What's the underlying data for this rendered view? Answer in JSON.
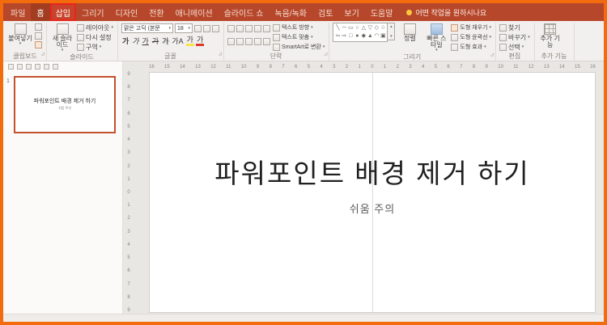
{
  "colors": {
    "frame": "#F26B0C",
    "tabbar_bg": "#B7472A",
    "annotation_red": "#E8251D",
    "selected_thumb_border": "#C4502E"
  },
  "tabbar": {
    "tell_me": "어떤 작업을 원하시나요",
    "tabs": [
      {
        "id": "file",
        "label": "파일"
      },
      {
        "id": "home",
        "label": "홈",
        "active": true
      },
      {
        "id": "insert",
        "label": "삽입",
        "annotated": true
      },
      {
        "id": "draw",
        "label": "그리기"
      },
      {
        "id": "design",
        "label": "디자인"
      },
      {
        "id": "transitions",
        "label": "전환"
      },
      {
        "id": "animations",
        "label": "애니메이션"
      },
      {
        "id": "slideshow",
        "label": "슬라이드 쇼"
      },
      {
        "id": "recording",
        "label": "녹음/녹화"
      },
      {
        "id": "review",
        "label": "검토"
      },
      {
        "id": "view",
        "label": "보기"
      },
      {
        "id": "help",
        "label": "도움말"
      }
    ]
  },
  "ribbon": {
    "clipboard": {
      "label": "클립보드",
      "paste": "붙여넣기"
    },
    "slides": {
      "label": "슬라이드",
      "new_slide": "새 슬라이드",
      "layout": "레이아웃",
      "reset": "다시 설정",
      "section": "구역"
    },
    "font": {
      "label": "글꼴",
      "font_name": "맑은 고딕 (본문",
      "font_size": "18",
      "style_buttons": [
        {
          "name": "bold-button",
          "glyph": "가",
          "cls": "b"
        },
        {
          "name": "italic-button",
          "glyph": "가",
          "cls": "i"
        },
        {
          "name": "underline-button",
          "glyph": "가",
          "cls": "u"
        },
        {
          "name": "strikethrough-button",
          "glyph": "가",
          "cls": "s"
        },
        {
          "name": "text-shadow-button",
          "glyph": "가",
          "cls": "sh"
        },
        {
          "name": "character-spacing-button",
          "glyph": "가A",
          "cls": ""
        },
        {
          "name": "highlight-color-button",
          "glyph": "가",
          "cls": "hl"
        },
        {
          "name": "font-color-button",
          "glyph": "가",
          "cls": "fc"
        }
      ]
    },
    "paragraph": {
      "label": "단락",
      "text_direction": "텍스트 방향",
      "align_text": "텍스트 맞춤",
      "smartart": "SmartArt로 변환",
      "icons1": [
        {
          "name": "bullets-button"
        },
        {
          "name": "numbering-button"
        },
        {
          "name": "decrease-indent-button"
        },
        {
          "name": "increase-indent-button"
        },
        {
          "name": "line-spacing-button"
        }
      ],
      "icons2": [
        {
          "name": "align-left-button"
        },
        {
          "name": "align-center-button"
        },
        {
          "name": "align-right-button"
        },
        {
          "name": "justify-button"
        },
        {
          "name": "columns-button"
        }
      ]
    },
    "drawing": {
      "label": "그리기",
      "arrange": "정렬",
      "quick_styles": "빠른 스타일",
      "shape_fill": "도형 채우기",
      "shape_outline": "도형 윤곽선",
      "shape_effects": "도형 효과",
      "shapes": [
        "╲",
        "─",
        "▭",
        "○",
        "△",
        "▽",
        "◇",
        "☆",
        "⇦",
        "⇨",
        "□",
        "●",
        "◆",
        "▲",
        "◠",
        "▣"
      ]
    },
    "editing": {
      "label": "편집",
      "find": "찾기",
      "replace": "바꾸기",
      "select": "선택"
    },
    "addins": {
      "label": "추가 기능",
      "button": "추가 기능"
    }
  },
  "qat": {
    "items": [
      {
        "name": "save-button"
      },
      {
        "name": "undo-button"
      },
      {
        "name": "redo-button"
      },
      {
        "name": "start-slideshow-button"
      },
      {
        "name": "print-button"
      },
      {
        "name": "customize-quick-access-button"
      }
    ]
  },
  "rulers": {
    "h": [
      "16",
      "15",
      "14",
      "13",
      "12",
      "11",
      "10",
      "9",
      "8",
      "7",
      "6",
      "5",
      "4",
      "3",
      "2",
      "1",
      "0",
      "1",
      "2",
      "3",
      "4",
      "5",
      "6",
      "7",
      "8",
      "9",
      "10",
      "11",
      "12",
      "13",
      "14",
      "15",
      "16"
    ],
    "v": [
      "9",
      "8",
      "7",
      "6",
      "5",
      "4",
      "3",
      "2",
      "1",
      "0",
      "1",
      "2",
      "3",
      "4",
      "5",
      "6",
      "7",
      "8",
      "9"
    ]
  },
  "thumbnails": {
    "number": "1",
    "title": "파워포인트 배경 제거 하기",
    "subtitle": "쉬움 주의"
  },
  "slide": {
    "title": "파워포인트 배경 제거 하기",
    "subtitle": "쉬움 주의"
  }
}
